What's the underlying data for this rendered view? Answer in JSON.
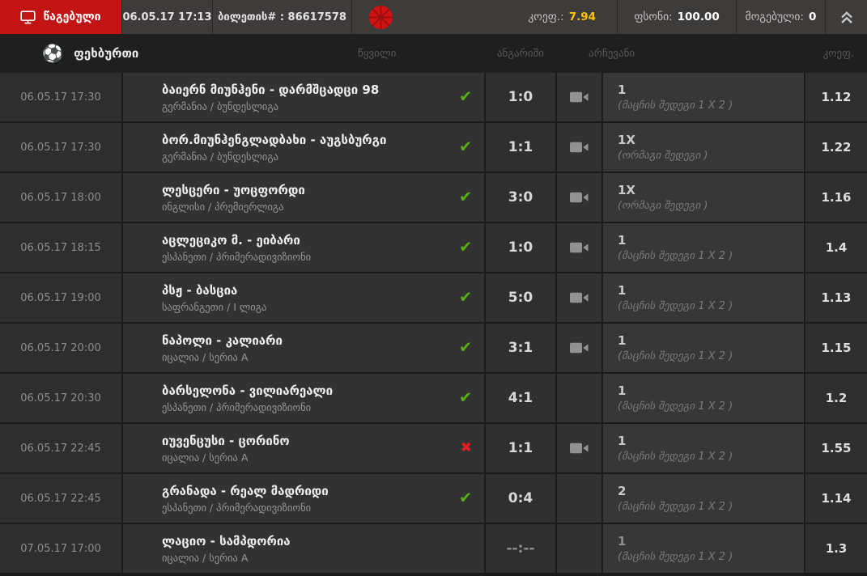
{
  "top_bar": {
    "status_label": "წაგებული",
    "datetime": "06.05.17 17:13",
    "ticket_label": "ბილეთის# : 86617578",
    "coef_label": "კოეფ.:",
    "coef_value": "7.94",
    "stake_label": "ფსონი:",
    "stake_value": "100.00",
    "won_label": "მოგებული:",
    "won_value": "0"
  },
  "icons": {
    "status_button": "monitor-icon",
    "ticket_badge": "red-wheel-icon",
    "collapse": "double-chevron-up-icon",
    "sport": "soccer-ball-icon",
    "stream": "video-camera-icon",
    "win": "check-icon",
    "loss": "cross-icon"
  },
  "colors": {
    "accent_red": "#c31414",
    "coef_yellow": "#fdc300",
    "win_green": "#55b211",
    "loss_red": "#e21b1b"
  },
  "table": {
    "sport": "ფეხბურთი",
    "headers": {
      "pair": "წყვილი",
      "score": "ანგარიში",
      "pick": "არჩევანი",
      "coef": "კოეფ."
    },
    "rows": [
      {
        "datetime": "06.05.17 17:30",
        "match": "ბაიერნ მიუნჰენი - დარმშცადცი 98",
        "league": "გერმანია / ბუნდესლიგა",
        "result": "win",
        "score": "1:0",
        "camera": true,
        "pick": "1",
        "pick_type": "(მაცჩის შედეგი 1 X 2 )",
        "coef": "1.12"
      },
      {
        "datetime": "06.05.17 17:30",
        "match": "ბორ.მიუნჰენგლადბახი - აუგსბურგი",
        "league": "გერმანია / ბუნდესლიგა",
        "result": "win",
        "score": "1:1",
        "camera": true,
        "pick": "1X",
        "pick_type": "(ორმაგი შედეგი )",
        "coef": "1.22"
      },
      {
        "datetime": "06.05.17 18:00",
        "match": "ლესცერი - უოცფორდი",
        "league": "ინგლისი / პრემიერლიგა",
        "result": "win",
        "score": "3:0",
        "camera": true,
        "pick": "1X",
        "pick_type": "(ორმაგი შედეგი )",
        "coef": "1.16"
      },
      {
        "datetime": "06.05.17 18:15",
        "match": "აცლეციკო მ. - ეიბარი",
        "league": "ესპანეთი / პრიმერადივიზიონი",
        "result": "win",
        "score": "1:0",
        "camera": true,
        "pick": "1",
        "pick_type": "(მაცჩის შედეგი 1 X 2 )",
        "coef": "1.4"
      },
      {
        "datetime": "06.05.17 19:00",
        "match": "პსჟ - ბასცია",
        "league": "საფრანგეთი / I ლიგა",
        "result": "win",
        "score": "5:0",
        "camera": true,
        "pick": "1",
        "pick_type": "(მაცჩის შედეგი 1 X 2 )",
        "coef": "1.13"
      },
      {
        "datetime": "06.05.17 20:00",
        "match": "ნაპოლი - კალიარი",
        "league": "იცალია / სერია A",
        "result": "win",
        "score": "3:1",
        "camera": true,
        "pick": "1",
        "pick_type": "(მაცჩის შედეგი 1 X 2 )",
        "coef": "1.15"
      },
      {
        "datetime": "06.05.17 20:30",
        "match": "ბარსელონა - ვილიარეალი",
        "league": "ესპანეთი / პრიმერადივიზიონი",
        "result": "win",
        "score": "4:1",
        "camera": false,
        "pick": "1",
        "pick_type": "(მაცჩის შედეგი 1 X 2 )",
        "coef": "1.2"
      },
      {
        "datetime": "06.05.17 22:45",
        "match": "იუვენცუსი - ცორინო",
        "league": "იცალია / სერია A",
        "result": "loss",
        "score": "1:1",
        "camera": true,
        "pick": "1",
        "pick_type": "(მაცჩის შედეგი 1 X 2 )",
        "coef": "1.55"
      },
      {
        "datetime": "06.05.17 22:45",
        "match": "გრანადა - რეალ მადრიდი",
        "league": "ესპანეთი / პრიმერადივიზიონი",
        "result": "win",
        "score": "0:4",
        "camera": false,
        "pick": "2",
        "pick_type": "(მაცჩის შედეგი 1 X 2 )",
        "coef": "1.14"
      },
      {
        "datetime": "07.05.17 17:00",
        "match": "ლაციო - სამპდორია",
        "league": "იცალია / სერია A",
        "result": "pending",
        "score": "--:--",
        "camera": false,
        "pick": "1",
        "pick_type": "(მაცჩის შედეგი 1 X 2 )",
        "coef": "1.3"
      }
    ]
  }
}
